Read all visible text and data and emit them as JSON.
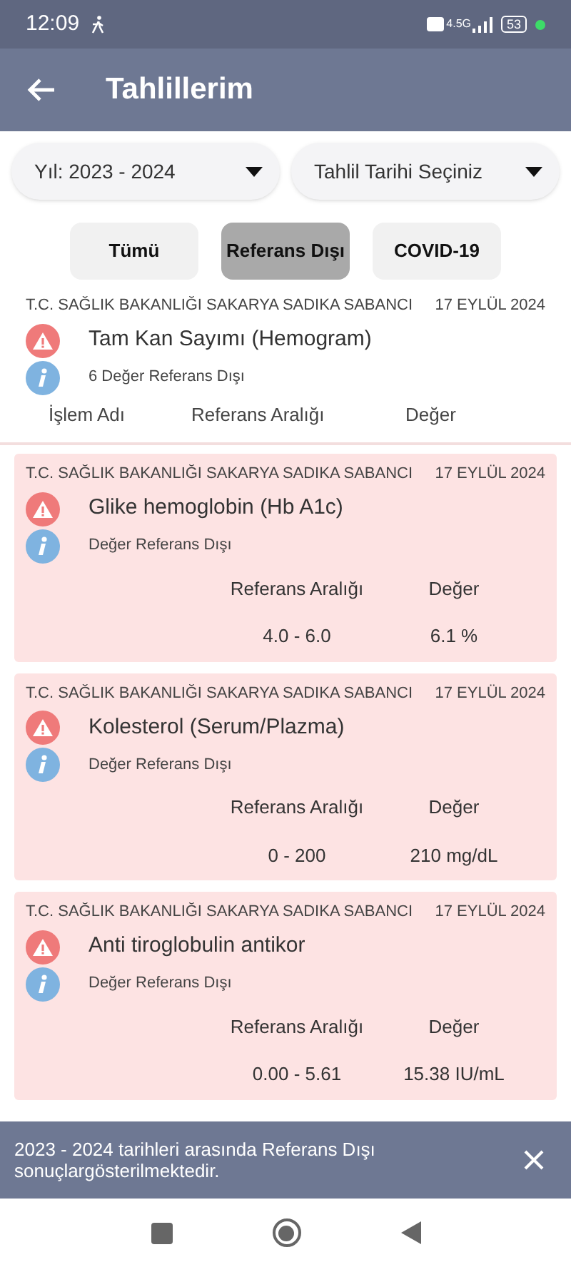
{
  "status_bar": {
    "time": "12:09",
    "network": "4.5G",
    "battery": "53"
  },
  "header": {
    "title": "Tahlillerim"
  },
  "filters": [
    {
      "label": "Yıl: 2023 - 2024"
    },
    {
      "label": "Tahlil Tarihi Seçiniz"
    }
  ],
  "tabs": [
    {
      "label": "Tümü",
      "selected": false
    },
    {
      "label": "Referans Dışı",
      "selected": true
    },
    {
      "label": "COVID-19",
      "selected": false
    }
  ],
  "group": {
    "hospital": "T.C. SAĞLIK BAKANLIĞI SAKARYA SADIKA SABANCI",
    "date": "17 EYLÜL 2024",
    "title": "Tam Kan Sayımı (Hemogram)",
    "subtitle": "6 Değer Referans Dışı",
    "columns": [
      "İşlem Adı",
      "Referans Aralığı",
      "Değer"
    ]
  },
  "results": [
    {
      "hospital": "T.C. SAĞLIK BAKANLIĞI SAKARYA SADIKA SABANCI",
      "date": "17 EYLÜL 2024",
      "title": "Glike hemoglobin (Hb A1c)",
      "subtitle": "Değer Referans Dışı",
      "range_label": "Referans Aralığı",
      "value_label": "Değer",
      "range": "4.0 - 6.0",
      "value": "6.1 %"
    },
    {
      "hospital": "T.C. SAĞLIK BAKANLIĞI SAKARYA SADIKA SABANCI",
      "date": "17 EYLÜL 2024",
      "title": "Kolesterol (Serum/Plazma)",
      "subtitle": "Değer Referans Dışı",
      "range_label": "Referans Aralığı",
      "value_label": "Değer",
      "range": "0 - 200",
      "value": "210 mg/dL"
    },
    {
      "hospital": "T.C. SAĞLIK BAKANLIĞI SAKARYA SADIKA SABANCI",
      "date": "17 EYLÜL 2024",
      "title": "Anti tiroglobulin antikor",
      "subtitle": "Değer Referans Dışı",
      "range_label": "Referans Aralığı",
      "value_label": "Değer",
      "range": "0.00 - 5.61",
      "value": "15.38 IU/mL"
    }
  ],
  "snackbar": {
    "message": "2023 - 2024 tarihleri arasında Referans Dışı sonuçlargösterilmektedir."
  }
}
